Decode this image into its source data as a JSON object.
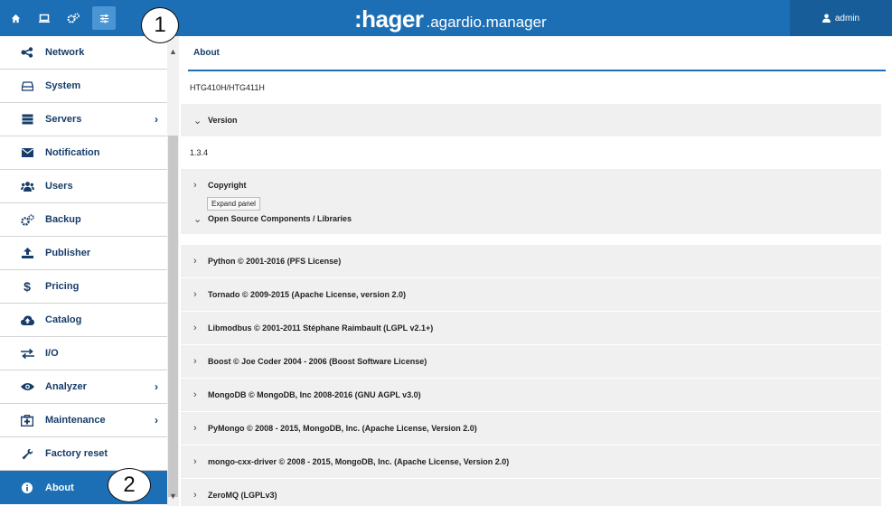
{
  "header": {
    "brand_main": ":hager",
    "brand_sub": ".agardio.manager",
    "user": "admin",
    "icons": [
      "home-icon",
      "monitor-icon",
      "gears-icon",
      "sliders-icon"
    ]
  },
  "callouts": [
    "1",
    "2"
  ],
  "sidebar": {
    "items": [
      {
        "label": "Network",
        "icon": "network-icon"
      },
      {
        "label": "System",
        "icon": "drive-icon"
      },
      {
        "label": "Servers",
        "icon": "server-icon",
        "chevron": true
      },
      {
        "label": "Notification",
        "icon": "envelope-icon"
      },
      {
        "label": "Users",
        "icon": "users-icon"
      },
      {
        "label": "Backup",
        "icon": "gears-icon"
      },
      {
        "label": "Publisher",
        "icon": "upload-icon"
      },
      {
        "label": "Pricing",
        "icon": "dollar-icon"
      },
      {
        "label": "Catalog",
        "icon": "cloud-upload-icon"
      },
      {
        "label": "I/O",
        "icon": "exchange-icon"
      },
      {
        "label": "Analyzer",
        "icon": "eye-icon",
        "chevron": true
      },
      {
        "label": "Maintenance",
        "icon": "medkit-icon",
        "chevron": true
      },
      {
        "label": "Factory reset",
        "icon": "wrench-icon"
      },
      {
        "label": "About",
        "icon": "info-icon",
        "active": true
      }
    ]
  },
  "main": {
    "title": "About",
    "product": "HTG410H/HTG411H",
    "version_label": "Version",
    "version_value": "1.3.4",
    "copyright_label": "Copyright",
    "tooltip": "Expand panel",
    "oss_label": "Open Source Components / Libraries",
    "libraries": [
      "Python © 2001-2016 (PFS License)",
      "Tornado © 2009-2015 (Apache License, version 2.0)",
      "Libmodbus © 2001-2011 Stéphane Raimbault (LGPL v2.1+)",
      "Boost © Joe Coder 2004 - 2006 (Boost Software License)",
      "MongoDB © MongoDB, Inc 2008-2016 (GNU AGPL v3.0)",
      "PyMongo © 2008 - 2015, MongoDB, Inc. (Apache License, Version 2.0)",
      "mongo-cxx-driver © 2008 - 2015, MongoDB, Inc. (Apache License, Version 2.0)",
      "ZeroMQ (LGPLv3)"
    ]
  },
  "colors": {
    "primary": "#1c6fb5",
    "dark": "#163c6a",
    "row_gray": "#f0f0f0"
  }
}
